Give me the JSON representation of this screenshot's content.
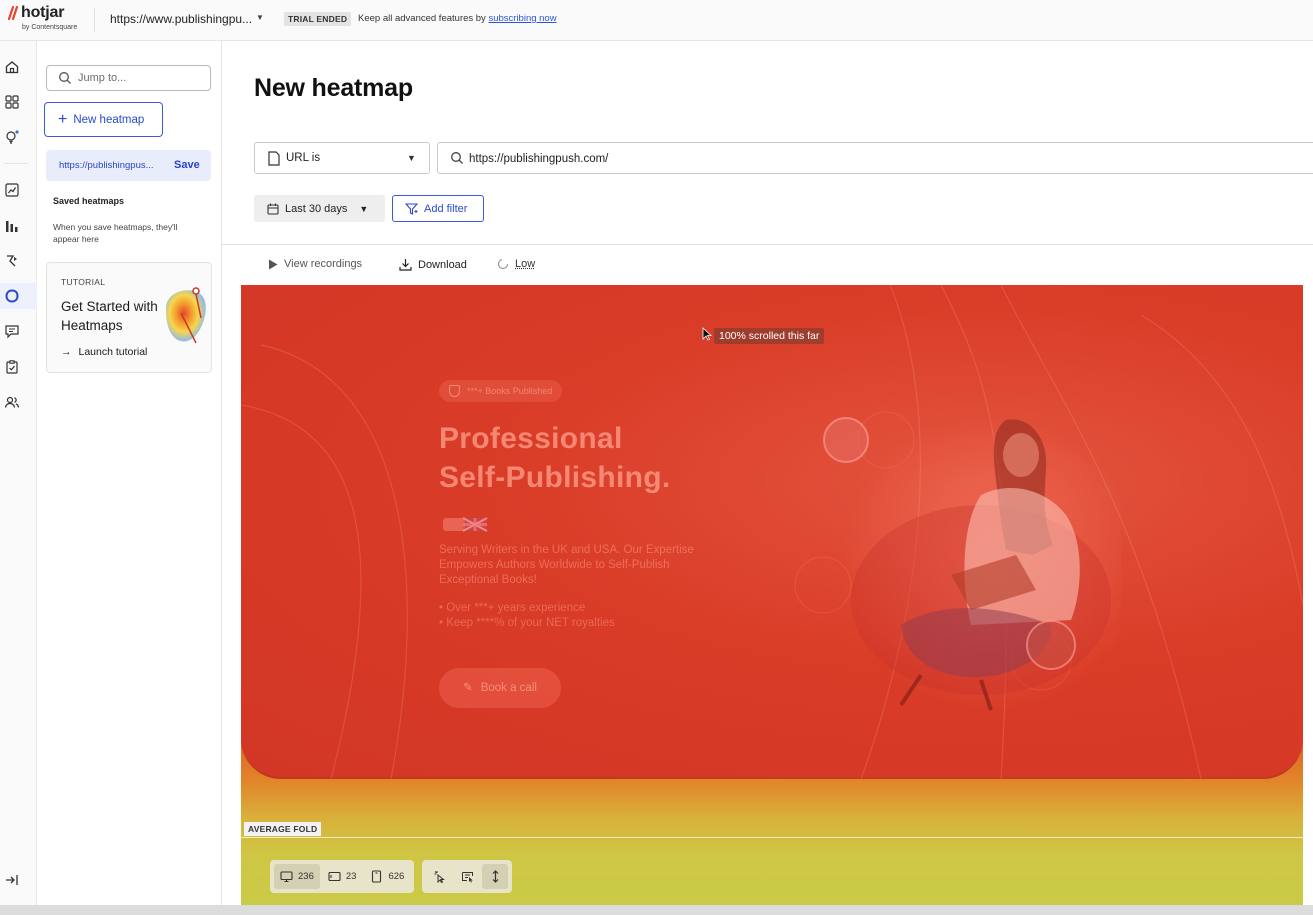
{
  "topbar": {
    "brand": "hotjar",
    "brand_sub": "by Contentsquare",
    "site_url": "https://www.publishingpu...",
    "trial_badge": "TRIAL ENDED",
    "trial_message": "Keep all advanced features by ",
    "trial_link": "subscribing now"
  },
  "rail": {
    "icons": [
      "home-icon",
      "dashboard-icon",
      "lightbulb-icon",
      "trends-icon",
      "funnels-icon",
      "recordings-icon",
      "heatmaps-icon",
      "feedback-icon",
      "surveys-icon",
      "users-icon",
      "collapse-icon"
    ]
  },
  "panel": {
    "search_placeholder": "Jump to...",
    "new_heatmap": "New heatmap",
    "current_url": "https://publishingpus...",
    "current_save": "Save",
    "saved_title": "Saved heatmaps",
    "saved_empty": "When you save heatmaps, they'll appear here",
    "tutorial_label": "TUTORIAL",
    "tutorial_title": "Get Started with Heatmaps",
    "tutorial_link": "Launch tutorial"
  },
  "main": {
    "title": "New heatmap",
    "url_condition": "URL is",
    "url_value": "https://publishingpush.com/",
    "date_range": "Last 30 days",
    "add_filter": "Add filter",
    "toolbar": {
      "view_recordings": "View recordings",
      "download": "Download",
      "quality": "Low"
    }
  },
  "heatmap": {
    "scroll_tooltip": "100% scrolled this far",
    "average_fold": "AVERAGE FOLD",
    "hero": {
      "badge": "***+ Books Published",
      "title_line1": "Professional",
      "title_line2": "Self-Publishing.",
      "description": "Serving Writers in the UK and USA. Our Expertise Empowers Authors Worldwide to Self-Publish Exceptional Books!",
      "bullet1": "• Over ***+ years experience",
      "bullet2": "• Keep ****% of your NET royalties",
      "cta": "Book a call"
    },
    "colors": {
      "hot": "#d93c26",
      "warm": "#e2862a",
      "cool": "#c9cb48"
    }
  },
  "bottom_bar": {
    "desktop_count": "236",
    "tablet_count": "23",
    "mobile_count": "626"
  }
}
